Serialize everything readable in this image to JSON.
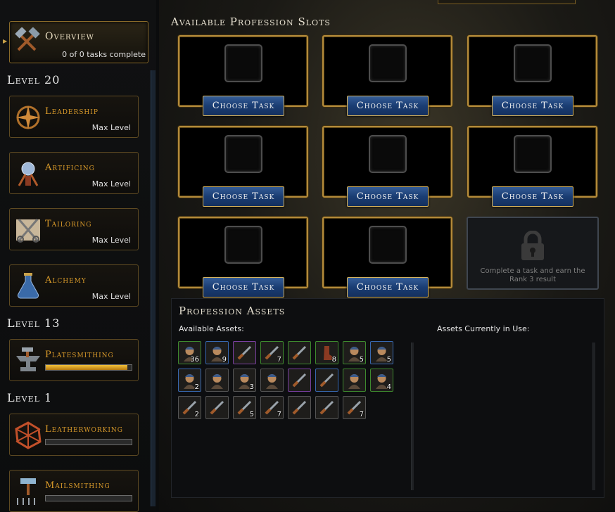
{
  "sidebar": {
    "overview": {
      "title": "Overview",
      "subtitle": "0 of 0 tasks complete"
    },
    "groups": [
      {
        "level": "Level 20",
        "professions": [
          {
            "name": "Leadership",
            "status": "Max Level",
            "icon": "leadership-icon"
          },
          {
            "name": "Artificing",
            "status": "Max Level",
            "icon": "artificing-icon"
          },
          {
            "name": "Tailoring",
            "status": "Max Level",
            "icon": "tailoring-icon"
          },
          {
            "name": "Alchemy",
            "status": "Max Level",
            "icon": "alchemy-icon"
          }
        ]
      },
      {
        "level": "Level 13",
        "professions": [
          {
            "name": "Platesmithing",
            "progress": 0.95,
            "icon": "platesmithing-icon"
          }
        ]
      },
      {
        "level": "Level 1",
        "professions": [
          {
            "name": "Leatherworking",
            "progress": 0,
            "icon": "leatherworking-icon"
          },
          {
            "name": "Mailsmithing",
            "progress": 0,
            "icon": "mailsmithing-icon"
          }
        ]
      }
    ]
  },
  "main": {
    "slots_title": "Available Profession Slots",
    "choose_task_label": "Choose Task",
    "locked_slot_text": "Complete a task and earn the Rank 3 result",
    "assets_title": "Profession Assets",
    "available_assets_label": "Available Assets:",
    "in_use_label": "Assets Currently in Use:",
    "assets": [
      {
        "icon": "hero-portrait-icon",
        "count": "36",
        "rarity": "g"
      },
      {
        "icon": "hero-portrait-icon",
        "count": "9",
        "rarity": "b"
      },
      {
        "icon": "crafting-tool-icon",
        "count": "",
        "rarity": "p"
      },
      {
        "icon": "crafting-tool-icon",
        "count": "7",
        "rarity": "g"
      },
      {
        "icon": "crafting-tool-icon",
        "count": "",
        "rarity": "g"
      },
      {
        "icon": "leather-boot-icon",
        "count": "8",
        "rarity": "g"
      },
      {
        "icon": "hero-portrait-icon",
        "count": "5",
        "rarity": "g"
      },
      {
        "icon": "hero-portrait-icon",
        "count": "5",
        "rarity": "b"
      },
      {
        "icon": "hero-portrait-icon",
        "count": "2",
        "rarity": "b"
      },
      {
        "icon": "hero-portrait-icon",
        "count": "",
        "rarity": "n"
      },
      {
        "icon": "hero-portrait-icon",
        "count": "3",
        "rarity": "n"
      },
      {
        "icon": "hero-portrait-icon",
        "count": "",
        "rarity": "n"
      },
      {
        "icon": "crafting-tool-icon",
        "count": "",
        "rarity": "p"
      },
      {
        "icon": "crafting-tool-icon",
        "count": "",
        "rarity": "b"
      },
      {
        "icon": "hero-portrait-icon",
        "count": "",
        "rarity": "g"
      },
      {
        "icon": "hero-portrait-icon",
        "count": "4",
        "rarity": "g"
      },
      {
        "icon": "crafting-tool-icon",
        "count": "2",
        "rarity": "n"
      },
      {
        "icon": "crafting-tool-icon",
        "count": "",
        "rarity": "n"
      },
      {
        "icon": "crafting-tool-icon",
        "count": "5",
        "rarity": "n"
      },
      {
        "icon": "crafting-tool-icon",
        "count": "7",
        "rarity": "n"
      },
      {
        "icon": "crafting-tool-icon",
        "count": "",
        "rarity": "n"
      },
      {
        "icon": "crafting-tool-icon",
        "count": "",
        "rarity": "n"
      },
      {
        "icon": "crafting-tool-icon",
        "count": "7",
        "rarity": "n"
      }
    ]
  },
  "colors": {
    "accent_gold": "#d99a2a",
    "button_blue": "#1a3d73",
    "rarity_green": "#3e8a2e",
    "rarity_blue": "#3868b0",
    "rarity_purple": "#7a3fa0"
  }
}
